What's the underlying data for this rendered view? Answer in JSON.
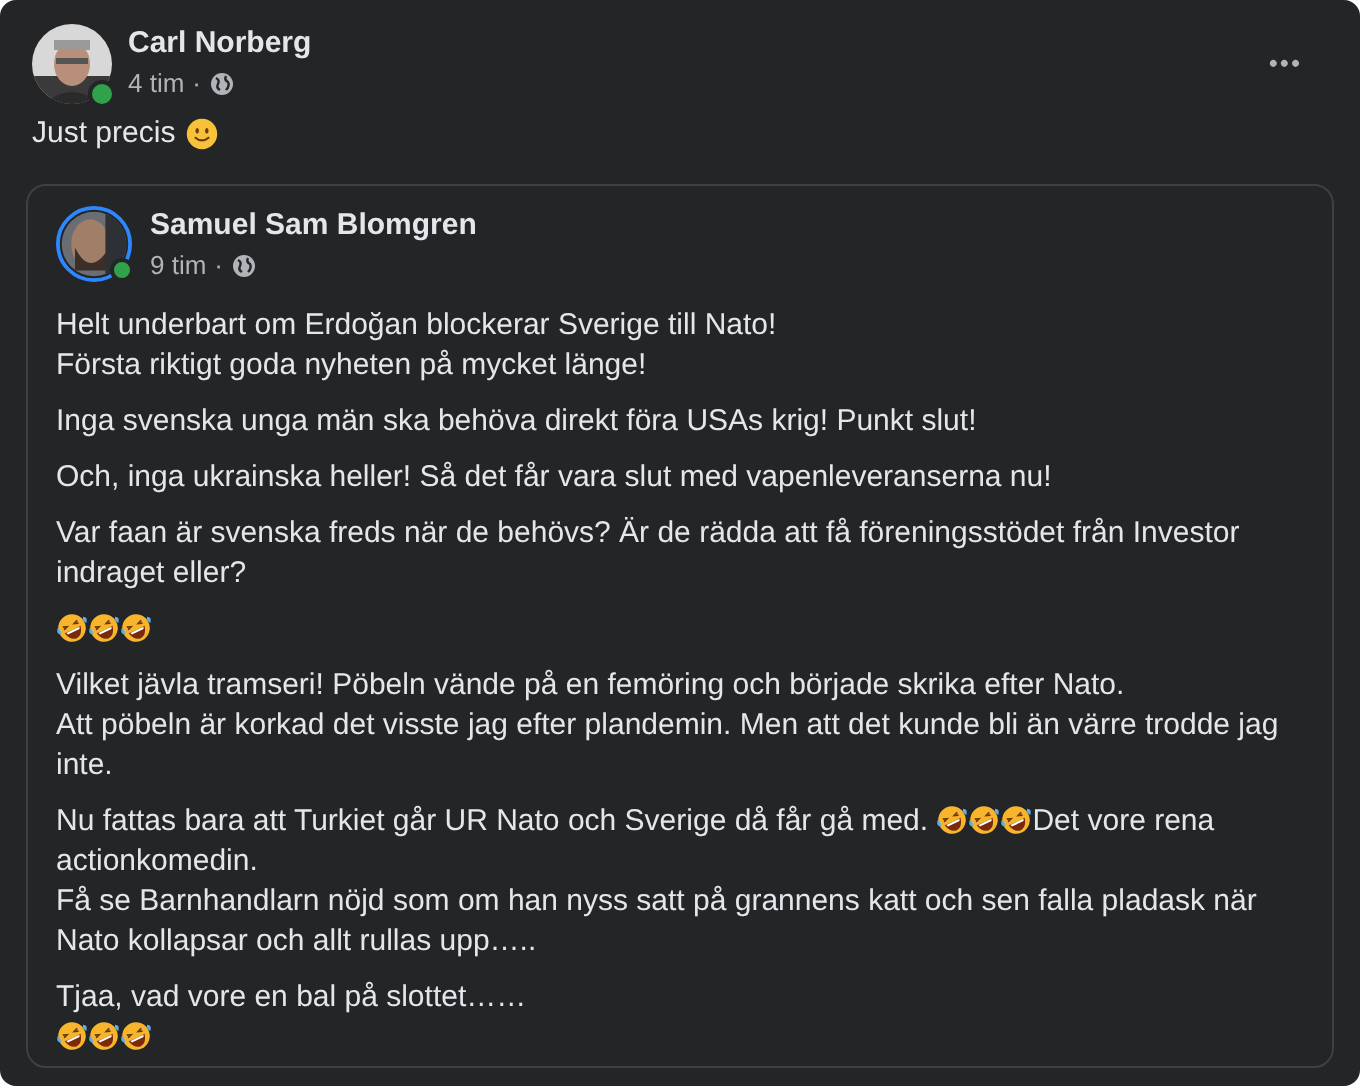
{
  "post": {
    "author": "Carl Norberg",
    "online": true,
    "time": "4 tim",
    "separator": "·",
    "menu": "•••",
    "text": [
      {
        "kind": "text",
        "text": "Just precis "
      },
      {
        "kind": "smile"
      }
    ],
    "shared": {
      "author": "Samuel Sam Blomgren",
      "online": true,
      "time": "9 tim",
      "separator": "·",
      "paragraphs": [
        [
          [
            {
              "kind": "text",
              "text": "Helt underbart om Erdoğan blockerar Sverige till Nato!"
            }
          ],
          [
            {
              "kind": "text",
              "text": "Första riktigt goda nyheten på mycket länge!"
            }
          ]
        ],
        [
          [
            {
              "kind": "text",
              "text": "Inga svenska unga män ska behöva direkt föra USAs krig! Punkt slut!"
            }
          ]
        ],
        [
          [
            {
              "kind": "text",
              "text": "Och, inga ukrainska heller! Så det får vara slut med vapenleveranserna nu!"
            }
          ]
        ],
        [
          [
            {
              "kind": "text",
              "text": "Var faan är svenska freds när de behövs? Är de rädda att få föreningsstödet från Investor indraget eller?"
            }
          ]
        ],
        [
          [
            {
              "kind": "rofl"
            },
            {
              "kind": "rofl"
            },
            {
              "kind": "rofl"
            }
          ]
        ],
        [
          [
            {
              "kind": "text",
              "text": "Vilket jävla tramseri! Pöbeln vände på en femöring och började skrika efter Nato."
            }
          ],
          [
            {
              "kind": "text",
              "text": "Att pöbeln är korkad det visste jag efter plandemin. Men att det kunde bli än värre trodde jag inte."
            }
          ]
        ],
        [
          [
            {
              "kind": "text",
              "text": "Nu fattas bara att Turkiet går UR Nato och Sverige då får gå med. "
            },
            {
              "kind": "rofl"
            },
            {
              "kind": "rofl"
            },
            {
              "kind": "rofl"
            },
            {
              "kind": "text",
              "text": "Det vore rena"
            }
          ],
          [
            {
              "kind": "text",
              "text": "actionkomedin."
            }
          ],
          [
            {
              "kind": "text",
              "text": "Få se Barnhandlarn nöjd som om han nyss satt på grannens katt och sen falla pladask när Nato kollapsar och allt rullas upp….."
            }
          ]
        ],
        [
          [
            {
              "kind": "text",
              "text": "Tjaa, vad vore en bal på slottet……"
            }
          ],
          [
            {
              "kind": "rofl"
            },
            {
              "kind": "rofl"
            },
            {
              "kind": "rofl"
            }
          ]
        ]
      ]
    }
  }
}
